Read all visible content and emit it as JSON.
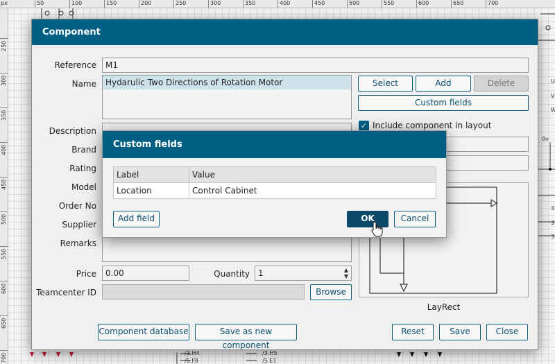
{
  "ruler": {
    "unit": "px",
    "top_ticks": [
      "50",
      "100",
      "150",
      "200",
      "250",
      "300",
      "350",
      "400",
      "450",
      "500",
      "550",
      "600",
      "650",
      "700"
    ],
    "left_ticks": [
      "250",
      "300",
      "350",
      "400",
      "450",
      "500",
      "550",
      "600",
      "650",
      "700"
    ]
  },
  "background": {
    "right_labels": [
      "U",
      "V",
      "W",
      "0v",
      "3",
      "3",
      "3"
    ],
    "bottom_refs": [
      "/3.H4",
      "/5.F8",
      "/3.H5",
      "/5.E1"
    ]
  },
  "dialog": {
    "title": "Component",
    "labels": {
      "reference": "Reference",
      "name": "Name",
      "description": "Description",
      "brand": "Brand",
      "rating": "Rating",
      "model": "Model",
      "order_no": "Order No",
      "supplier": "Supplier",
      "remarks": "Remarks",
      "price": "Price",
      "quantity": "Quantity",
      "teamcenter_id": "Teamcenter ID"
    },
    "values": {
      "reference": "M1",
      "name": "Hydarulic Two Directions of Rotation Motor",
      "price": "0.00",
      "quantity": "1",
      "teamcenter_id": ""
    },
    "buttons": {
      "select": "Select",
      "add": "Add",
      "delete": "Delete",
      "custom_fields": "Custom fields",
      "browse": "Browse",
      "component_database": "Component database",
      "save_as_new": "Save as new component",
      "reset": "Reset",
      "save": "Save",
      "close": "Close"
    },
    "include_in_layout": {
      "label": "Include component in layout",
      "checked": true
    },
    "preview_label": "LayRect"
  },
  "custom_fields": {
    "title": "Custom fields",
    "columns": [
      "Label",
      "Value"
    ],
    "rows": [
      {
        "label": "Location",
        "value": "Control Cabinet"
      }
    ],
    "buttons": {
      "add_field": "Add field",
      "ok": "OK",
      "cancel": "Cancel"
    }
  },
  "colors": {
    "header": "#015f84",
    "button_border": "#0c5f81",
    "primary_button": "#0d4a6a"
  }
}
